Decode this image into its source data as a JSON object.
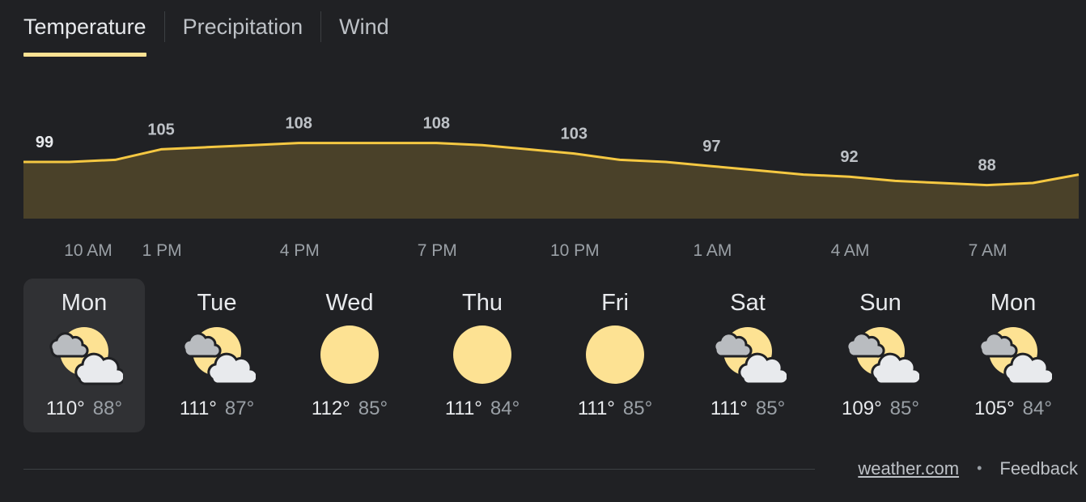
{
  "tabs": [
    {
      "label": "Temperature",
      "active": true
    },
    {
      "label": "Precipitation",
      "active": false
    },
    {
      "label": "Wind",
      "active": false
    }
  ],
  "colors": {
    "background": "#202124",
    "accent": "#fde293",
    "line": "#f5c842",
    "area_fill": "#4a4129",
    "selected_card": "#303134",
    "sun": "#fde293",
    "cloud": "#e8eaed"
  },
  "chart_data": {
    "type": "area",
    "x": [
      "10 AM",
      "11 AM",
      "12 PM",
      "1 PM",
      "2 PM",
      "3 PM",
      "4 PM",
      "5 PM",
      "6 PM",
      "7 PM",
      "8 PM",
      "9 PM",
      "10 PM",
      "11 PM",
      "12 AM",
      "1 AM",
      "2 AM",
      "3 AM",
      "4 AM",
      "5 AM",
      "6 AM",
      "7 AM",
      "8 AM",
      "9 AM"
    ],
    "series": [
      {
        "values": [
          99,
          99,
          100,
          105,
          106,
          107,
          108,
          108,
          108,
          108,
          107,
          105,
          103,
          100,
          99,
          97,
          95,
          93,
          92,
          90,
          89,
          88,
          89,
          93
        ]
      }
    ],
    "data_labels": [
      "99",
      "105",
      "108",
      "108",
      "103",
      "97",
      "92",
      "88"
    ],
    "x_ticks": [
      "10 AM",
      "1 PM",
      "4 PM",
      "7 PM",
      "10 PM",
      "1 AM",
      "4 AM",
      "7 AM"
    ],
    "ylim": [
      70,
      115
    ],
    "grid": false
  },
  "days": [
    {
      "name": "Mon",
      "icon": "partly-cloudy-icon",
      "high": "110°",
      "low": "88°",
      "selected": true
    },
    {
      "name": "Tue",
      "icon": "partly-cloudy-icon",
      "high": "111°",
      "low": "87°",
      "selected": false
    },
    {
      "name": "Wed",
      "icon": "sunny-icon",
      "high": "112°",
      "low": "85°",
      "selected": false
    },
    {
      "name": "Thu",
      "icon": "sunny-icon",
      "high": "111°",
      "low": "84°",
      "selected": false
    },
    {
      "name": "Fri",
      "icon": "sunny-icon",
      "high": "111°",
      "low": "85°",
      "selected": false
    },
    {
      "name": "Sat",
      "icon": "partly-cloudy-icon",
      "high": "111°",
      "low": "85°",
      "selected": false
    },
    {
      "name": "Sun",
      "icon": "partly-cloudy-icon",
      "high": "109°",
      "low": "85°",
      "selected": false
    },
    {
      "name": "Mon",
      "icon": "partly-cloudy-icon",
      "high": "105°",
      "low": "84°",
      "selected": false
    }
  ],
  "footer": {
    "source": "weather.com",
    "separator": "•",
    "feedback": "Feedback"
  }
}
